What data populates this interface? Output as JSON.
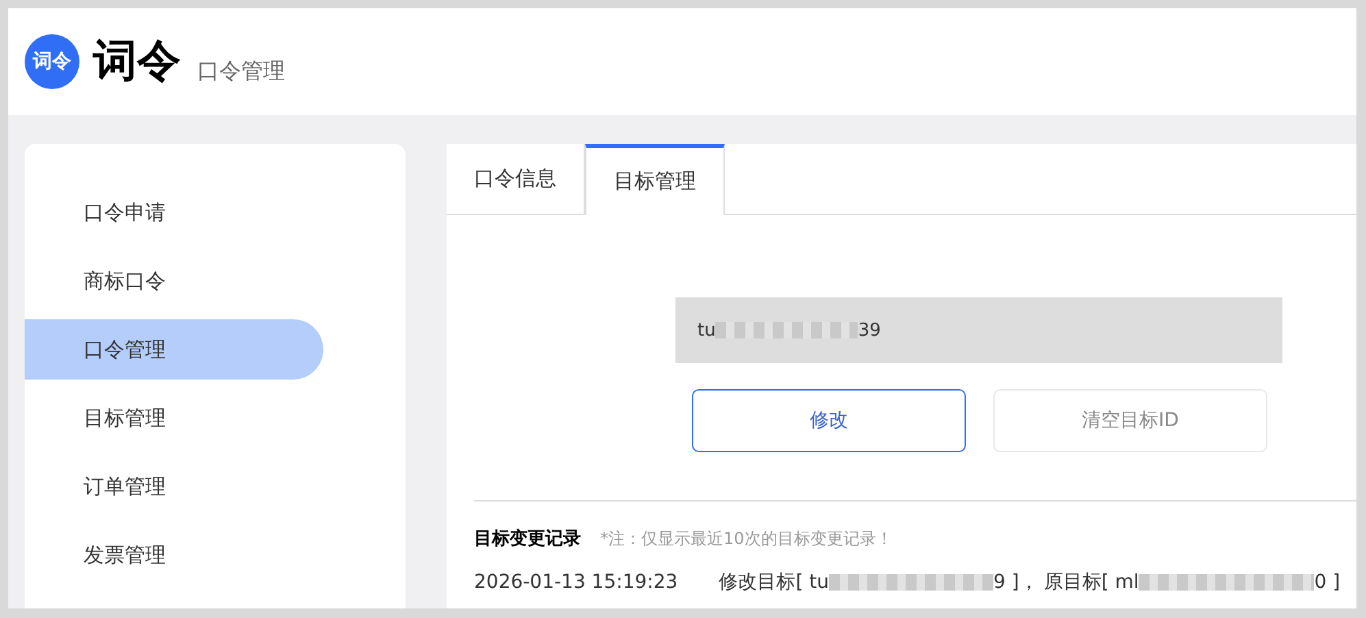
{
  "header": {
    "logo_text": "词令",
    "brand": "词令",
    "subtitle": "口令管理"
  },
  "sidebar": {
    "items": [
      {
        "label": "口令申请",
        "selected": false
      },
      {
        "label": "商标口令",
        "selected": false
      },
      {
        "label": "口令管理",
        "selected": true
      },
      {
        "label": "目标管理",
        "selected": false
      },
      {
        "label": "订单管理",
        "selected": false
      },
      {
        "label": "发票管理",
        "selected": false
      }
    ]
  },
  "tabs": [
    {
      "label": "口令信息",
      "selected": false
    },
    {
      "label": "目标管理",
      "selected": true
    }
  ],
  "target_field": {
    "value_start": "tu",
    "value_end": "39"
  },
  "buttons": [
    {
      "label": "修改",
      "kind": "primary"
    },
    {
      "label": "清空目标ID",
      "kind": "default"
    }
  ],
  "history": {
    "title": "目标变更记录",
    "note": "*注：仅显示最近10次的目标变更记录！",
    "rows": [
      {
        "time": "2026-01-13 15:19:23",
        "new_prefix": "修改目标[ tu",
        "new_suffix": "9 ]，",
        "old_prefix": "原目标[ ml",
        "old_suffix": "0 ]"
      }
    ]
  }
}
